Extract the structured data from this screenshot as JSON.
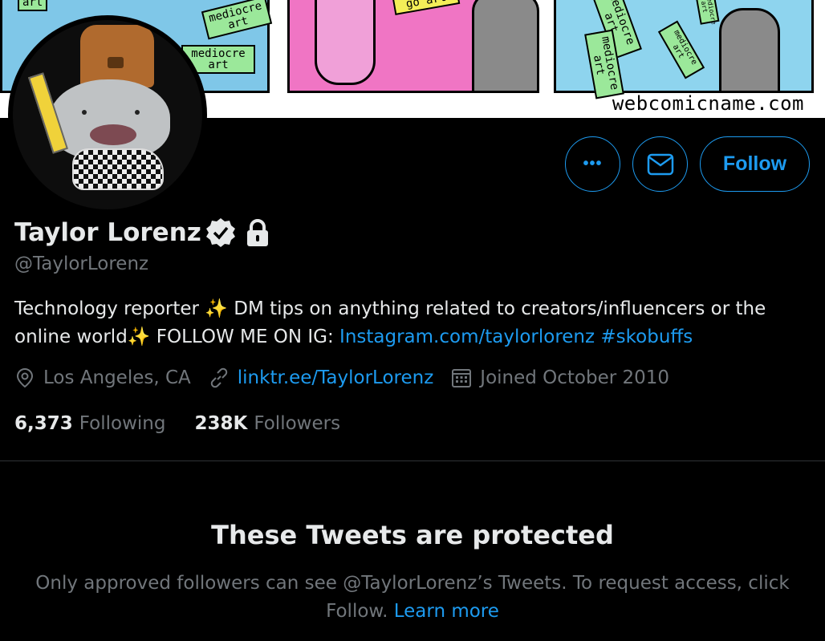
{
  "banner": {
    "url_text": "webcomicname.com",
    "signs": [
      "art",
      "mediocre art",
      "mediocre art",
      "go art",
      "mediocre art",
      "mediocre art",
      "mediocre art",
      "mediocre art"
    ]
  },
  "profile": {
    "display_name": "Taylor Lorenz",
    "handle": "@TaylorLorenz",
    "verified_icon": "verified-badge-icon",
    "lock_icon": "lock-icon",
    "bio": {
      "text1": "Technology reporter ",
      "emoji1": "✨",
      "text2": " DM tips on anything related to creators/influencers or the online world",
      "emoji2": "✨",
      "text3": " FOLLOW ME ON IG: ",
      "link1": "Instagram.com/taylorlorenz",
      "space": " ",
      "hashtag": "#skobuffs"
    },
    "location": "Los Angeles, CA",
    "website": "linktr.ee/TaylorLorenz",
    "joined": "Joined October 2010",
    "following_count": "6,373",
    "following_label": "Following",
    "followers_count": "238K",
    "followers_label": "Followers"
  },
  "actions": {
    "more_label": "•••",
    "follow_label": "Follow"
  },
  "protected": {
    "title": "These Tweets are protected",
    "text": "Only approved followers can see @TaylorLorenz’s Tweets. To request access, click Follow. ",
    "learn_more": "Learn more"
  },
  "colors": {
    "accent": "#1d9bf0",
    "background": "#000000",
    "text": "#e7e9ea",
    "muted": "#71767b",
    "divider": "#2f3336"
  }
}
